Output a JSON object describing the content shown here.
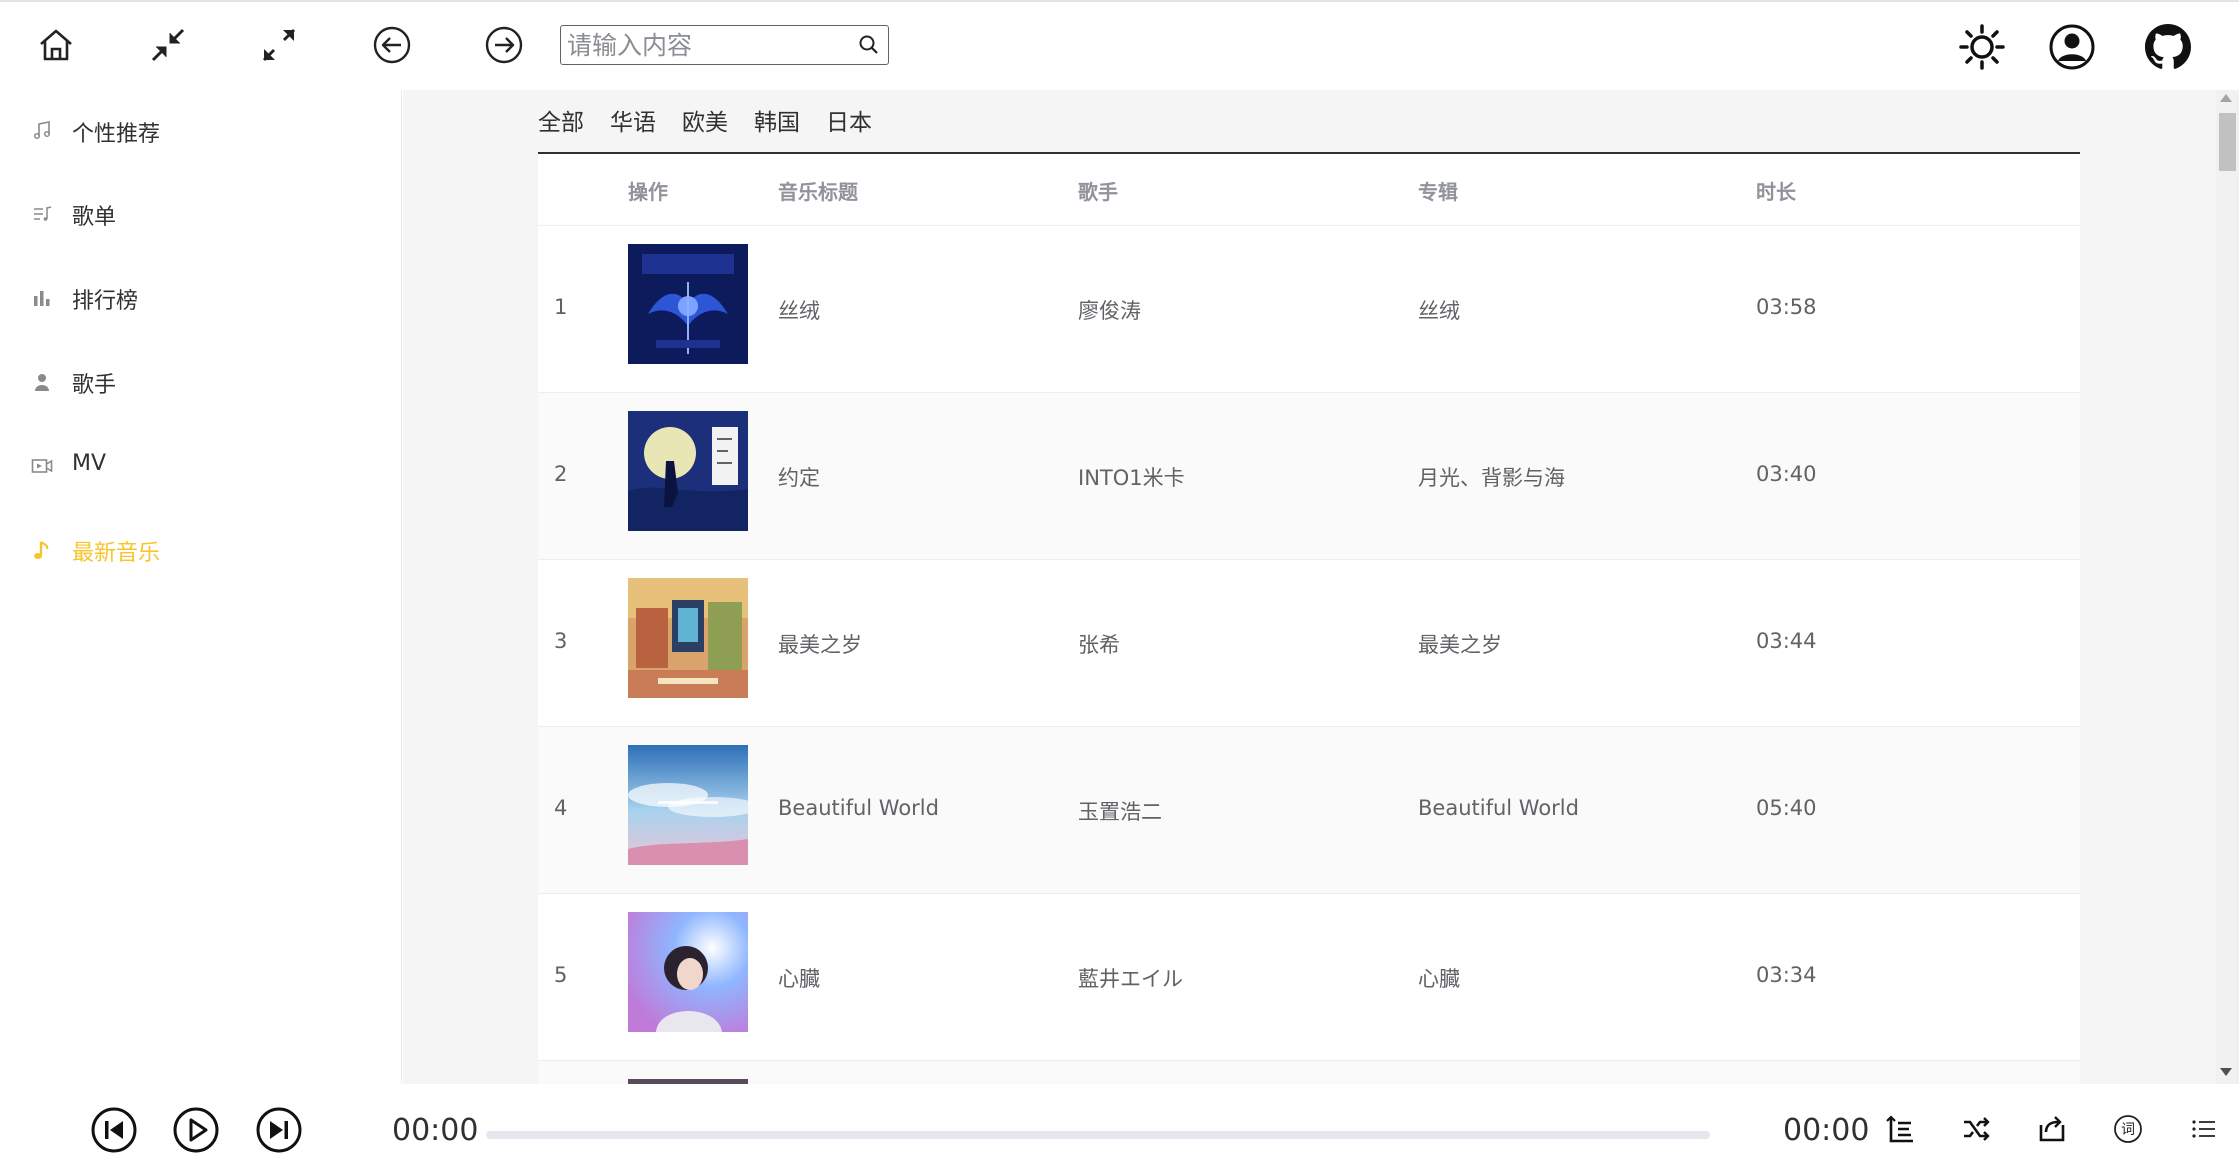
{
  "header": {
    "search_placeholder": "请输入内容",
    "icons": [
      "home-icon",
      "shrink-icon",
      "expand-icon",
      "back-icon",
      "forward-icon",
      "search-icon",
      "theme-sun-icon",
      "user-icon",
      "github-icon"
    ]
  },
  "sidebar": {
    "items": [
      {
        "label": "个性推荐",
        "icon": "music-note-icon",
        "active": false
      },
      {
        "label": "歌单",
        "icon": "playlist-icon",
        "active": false
      },
      {
        "label": "排行榜",
        "icon": "bar-chart-icon",
        "active": false
      },
      {
        "label": "歌手",
        "icon": "singer-icon",
        "active": false
      },
      {
        "label": "MV",
        "icon": "video-icon",
        "active": false
      },
      {
        "label": "最新音乐",
        "icon": "note-icon",
        "active": true
      }
    ]
  },
  "main": {
    "tabs": [
      "全部",
      "华语",
      "欧美",
      "韩国",
      "日本"
    ],
    "table": {
      "columns": [
        "",
        "操作",
        "音乐标题",
        "歌手",
        "专辑",
        "时长"
      ],
      "rows": [
        {
          "index": "1",
          "title": "丝绒",
          "artist": "廖俊涛",
          "album": "丝绒",
          "duration": "03:58"
        },
        {
          "index": "2",
          "title": "约定",
          "artist": "INTO1米卡",
          "album": "月光、背影与海",
          "duration": "03:40"
        },
        {
          "index": "3",
          "title": "最美之岁",
          "artist": "张希",
          "album": "最美之岁",
          "duration": "03:44"
        },
        {
          "index": "4",
          "title": "Beautiful World",
          "artist": "玉置浩二",
          "album": "Beautiful World",
          "duration": "05:40"
        },
        {
          "index": "5",
          "title": "心臓",
          "artist": "藍井エイル",
          "album": "心臓",
          "duration": "03:34"
        }
      ]
    }
  },
  "player": {
    "current_time": "00:00",
    "total_time": "00:00",
    "progress": 0,
    "colors": {
      "accent": "#f7c52b",
      "track": "#e4e7ed"
    }
  }
}
